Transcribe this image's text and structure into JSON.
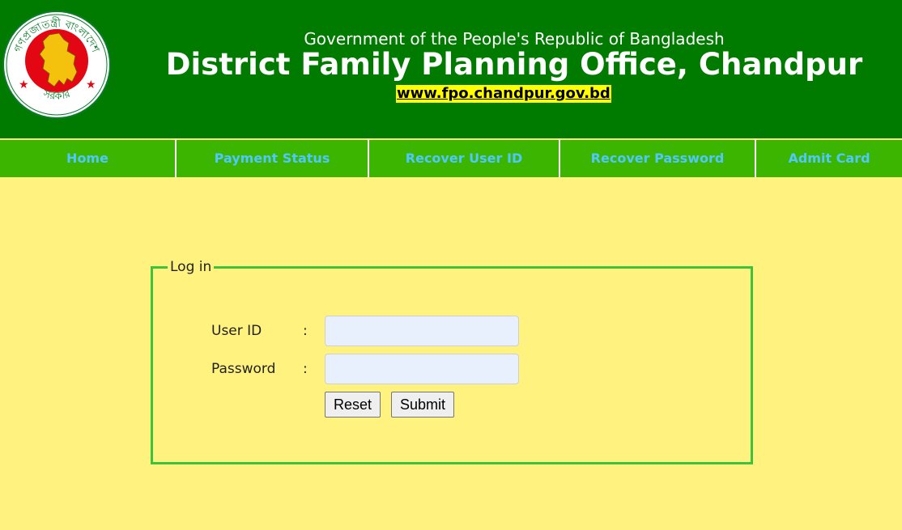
{
  "header": {
    "government_line": "Government of the People's Republic of Bangladesh",
    "office_title": "District Family Planning Office, Chandpur",
    "website": "www.fpo.chandpur.gov.bd",
    "emblem": {
      "icon": "bangladesh-government-seal-icon",
      "top_text": "গণপ্রজাতন্ত্রী বাংলাদেশ",
      "bottom_text": "সরকার"
    }
  },
  "nav": {
    "items": [
      {
        "label": "Home"
      },
      {
        "label": "Payment Status"
      },
      {
        "label": "Recover User ID"
      },
      {
        "label": "Recover Password"
      },
      {
        "label": "Admit Card"
      }
    ]
  },
  "login": {
    "legend": "Log in",
    "user_id_label": "User ID",
    "password_label": "Password",
    "colon": ":",
    "user_id_value": "",
    "password_value": "",
    "reset_label": "Reset",
    "submit_label": "Submit"
  },
  "colors": {
    "header_bg": "#007b00",
    "nav_bg": "#3cb500",
    "nav_text": "#4fc7ff",
    "page_bg": "#fff27f",
    "login_border": "#3cc33c",
    "input_bg": "#e8f0fe",
    "url_highlight": "#ffff00"
  }
}
